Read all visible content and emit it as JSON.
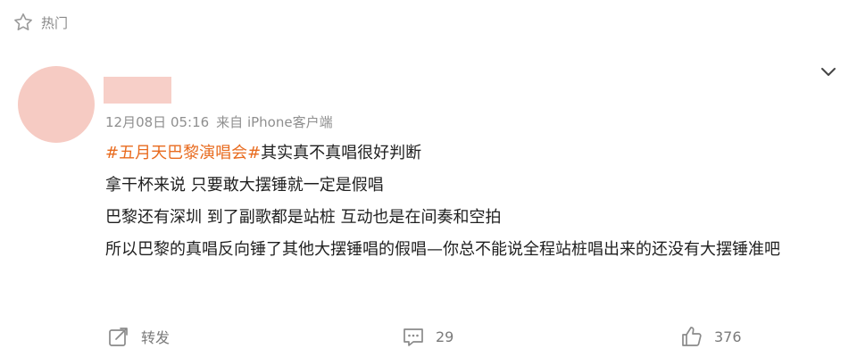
{
  "header": {
    "hot_icon": "star-outline-icon",
    "hot_label": "热门"
  },
  "post": {
    "collapse_icon": "chevron-down-icon",
    "timestamp": "12月08日 05:16",
    "source": "来自 iPhone客户端",
    "topic": "#五月天巴黎演唱会#",
    "lines": [
      "其实真不真唱很好判断",
      "拿干杯来说 只要敢大摆锤就一定是假唱",
      "巴黎还有深圳 到了副歌都是站桩 互动也是在间奏和空拍",
      "所以巴黎的真唱反向锤了其他大摆锤唱的假唱—你总不能说全程站桩唱出来的还没有大摆锤准吧"
    ]
  },
  "actions": {
    "repost_label": "转发",
    "repost_icon": "share-icon",
    "comment_count": "29",
    "comment_icon": "comment-icon",
    "like_count": "376",
    "like_icon": "thumbs-up-icon"
  },
  "colors": {
    "topic": "#e86b1f",
    "avatar": "#f6cbc3",
    "username_placeholder": "#f7cfc8",
    "secondary_text": "#8f8f8f"
  }
}
